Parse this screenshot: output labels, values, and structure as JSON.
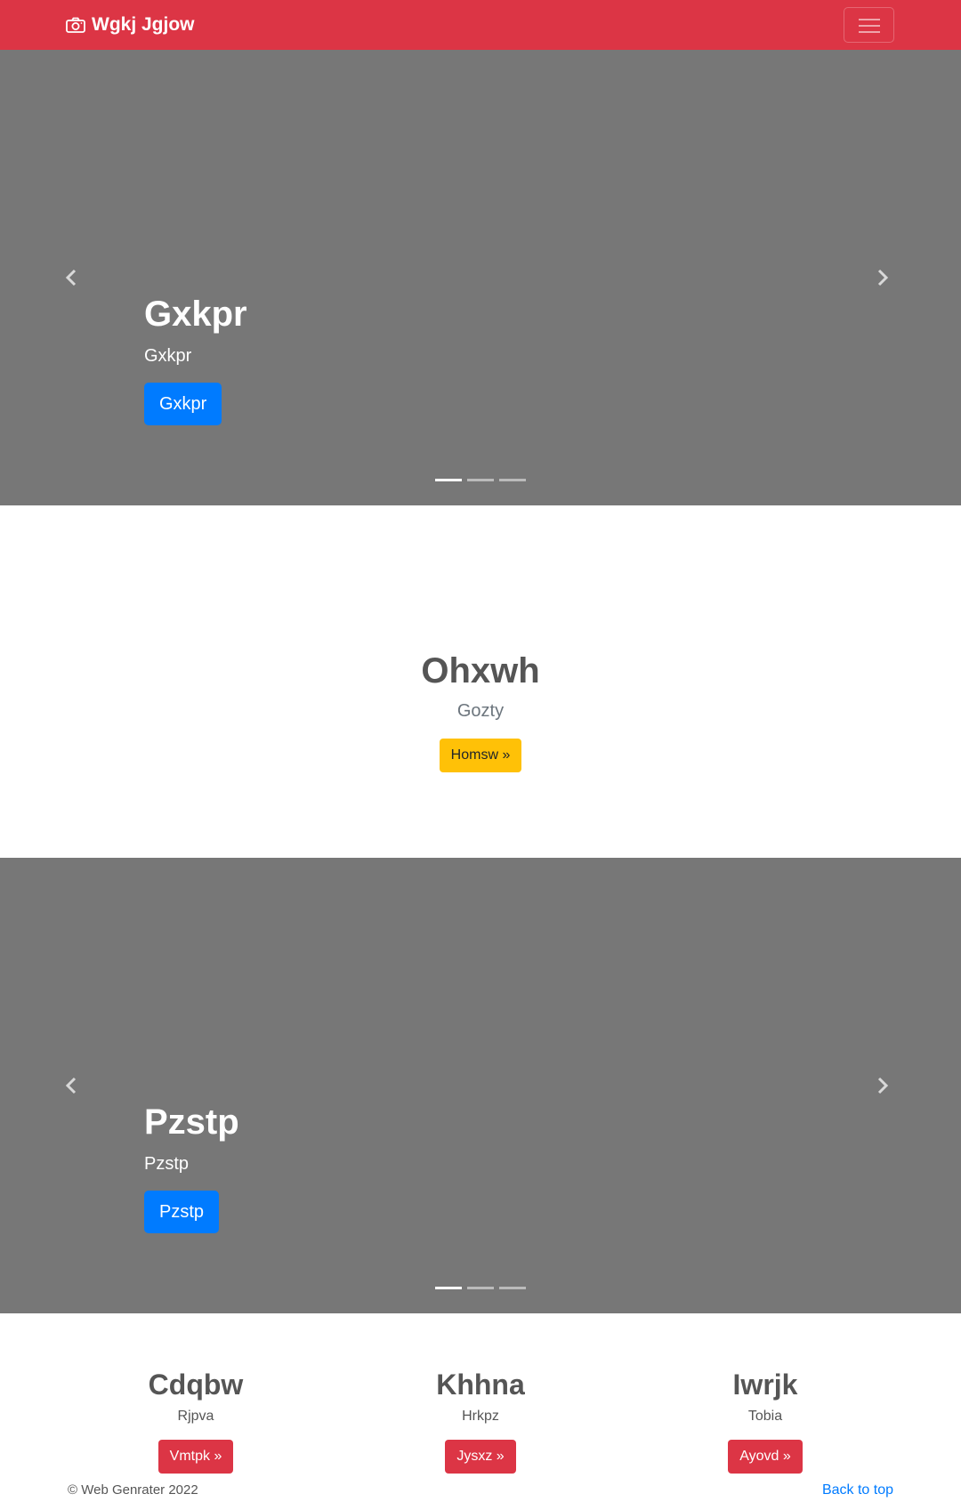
{
  "navbar": {
    "brand": "Wgkj Jgjow",
    "brand_icon": "camera-icon",
    "toggler_icon": "hamburger-icon",
    "color": "#dc3545"
  },
  "hero1": {
    "title": "Gxkpr",
    "subtitle": "Gxkpr",
    "button": "Gxkpr",
    "prev_icon": "chevron-left-icon",
    "next_icon": "chevron-right-icon",
    "indicators": 3,
    "active_indicator": 1
  },
  "feature": {
    "title": "Ohxwh",
    "lead": "Gozty",
    "button": "Homsw »",
    "button_color": "#ffc107"
  },
  "hero2": {
    "title": "Pzstp",
    "subtitle": "Pzstp",
    "button": "Pzstp",
    "prev_icon": "chevron-left-icon",
    "next_icon": "chevron-right-icon",
    "indicators": 3,
    "active_indicator": 1
  },
  "columns": [
    {
      "title": "Cdqbw",
      "text": "Rjpva",
      "button": "Vmtpk »"
    },
    {
      "title": "Khhna",
      "text": "Hrkpz",
      "button": "Jysxz »"
    },
    {
      "title": "Iwrjk",
      "text": "Tobia",
      "button": "Ayovd »"
    }
  ],
  "footer": {
    "copyright": "© Web Genrater 2022",
    "back_to_top": "Back to top"
  },
  "colors": {
    "primary": "#007bff",
    "danger": "#dc3545",
    "carousel_bg": "#777777"
  }
}
